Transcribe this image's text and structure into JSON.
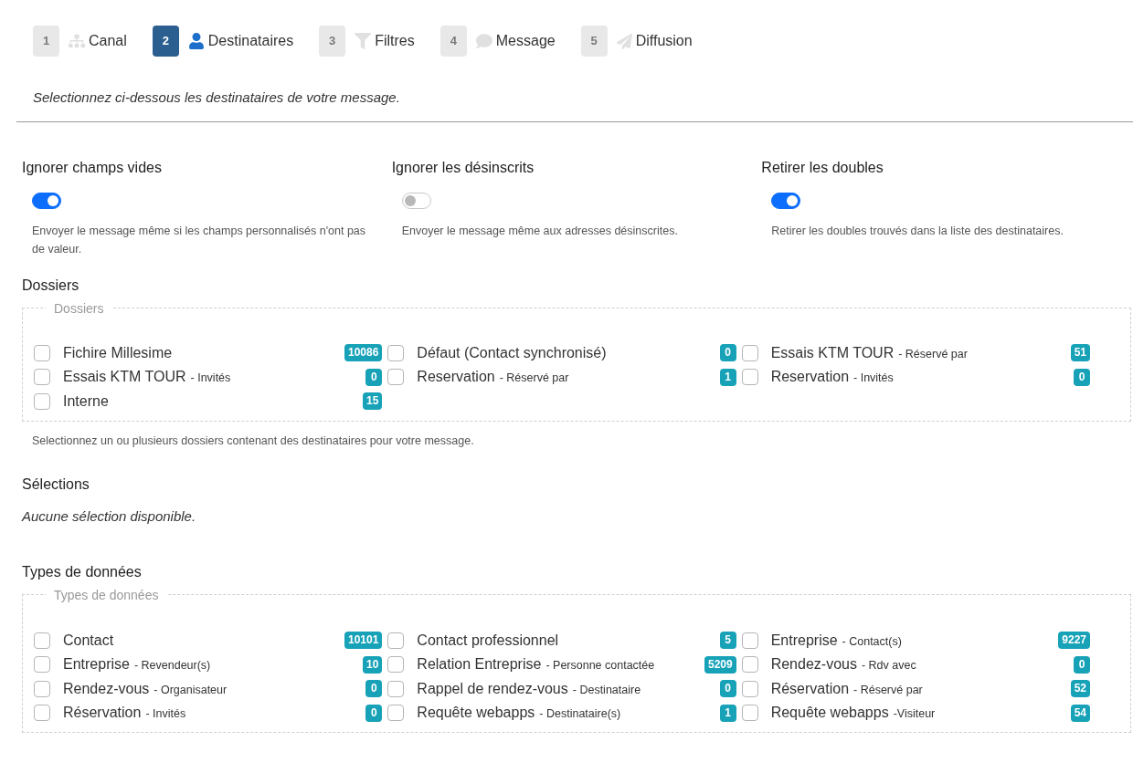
{
  "steps": [
    {
      "number": "1",
      "label": "Canal",
      "selected": false
    },
    {
      "number": "2",
      "label": "Destinataires",
      "selected": true
    },
    {
      "number": "3",
      "label": "Filtres",
      "selected": false
    },
    {
      "number": "4",
      "label": "Message",
      "selected": false
    },
    {
      "number": "5",
      "label": "Diffusion",
      "selected": false
    }
  ],
  "intro": "Selectionnez ci-dessous les destinataires de votre message.",
  "options": [
    {
      "title": "Ignorer champs vides",
      "on": true,
      "help": "Envoyer le message même si les champs personnalisés n'ont pas de valeur."
    },
    {
      "title": "Ignorer les désinscrits",
      "on": false,
      "help": "Envoyer le message même aux adresses désinscrites."
    },
    {
      "title": "Retirer les doubles",
      "on": true,
      "help": "Retirer les doubles trouvés dans la liste des destinataires."
    }
  ],
  "dossiers": {
    "heading": "Dossiers",
    "legend": "Dossiers",
    "items": [
      {
        "label": "Fichire Millesime",
        "count": "10086",
        "checked": false
      },
      {
        "label": "Défaut (Contact synchronisé)",
        "count": "0",
        "checked": false
      },
      {
        "label": "Essais KTM TOUR",
        "sub": "- Réservé par",
        "count": "51",
        "checked": false
      },
      {
        "label": "Essais KTM TOUR",
        "sub": "- Invités",
        "count": "0",
        "checked": false
      },
      {
        "label": "Reservation",
        "sub": "- Réservé par",
        "count": "1",
        "checked": false
      },
      {
        "label": "Reservation",
        "sub": "- Invités",
        "count": "0",
        "checked": false
      },
      {
        "label": "Interne",
        "count": "15",
        "checked": false
      }
    ],
    "help": "Selectionnez un ou plusieurs dossiers contenant des destinataires pour votre message."
  },
  "selections": {
    "heading": "Sélections",
    "empty": "Aucune sélection disponible."
  },
  "types": {
    "heading": "Types de données",
    "legend": "Types de données",
    "items": [
      {
        "label": "Contact",
        "count": "10101",
        "checked": false
      },
      {
        "label": "Contact professionnel",
        "count": "5",
        "checked": false
      },
      {
        "label": "Entreprise",
        "sub": "- Contact(s)",
        "count": "9227",
        "checked": false
      },
      {
        "label": "Entreprise",
        "sub": "- Revendeur(s)",
        "count": "10",
        "checked": false
      },
      {
        "label": "Relation Entreprise",
        "sub": "- Personne contactée",
        "count": "5209",
        "checked": false
      },
      {
        "label": "Rendez-vous",
        "sub": "- Rdv avec",
        "count": "0",
        "checked": false
      },
      {
        "label": "Rendez-vous",
        "sub": "- Organisateur",
        "count": "0",
        "checked": false
      },
      {
        "label": "Rappel de rendez-vous",
        "sub": "- Destinataire",
        "count": "0",
        "checked": false
      },
      {
        "label": "Réservation",
        "sub": "- Réservé par",
        "count": "52",
        "checked": false
      },
      {
        "label": "Réservation",
        "sub": "- Invités",
        "count": "0",
        "checked": false
      },
      {
        "label": "Requête webapps",
        "sub": "- Destinataire(s)",
        "count": "1",
        "checked": false
      },
      {
        "label": "Requête webapps",
        "sub": "-Visiteur",
        "count": "54",
        "checked": false
      }
    ]
  }
}
